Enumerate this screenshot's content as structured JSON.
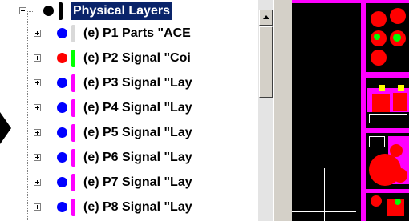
{
  "tree": {
    "root": {
      "label": "Physical Layers"
    },
    "items": [
      {
        "label": "(e) P1 Parts \"ACE",
        "dot_color": "#0000ff",
        "bar_color": "#d9d9d9"
      },
      {
        "label": "(e) P2 Signal \"Coi",
        "dot_color": "#ff0000",
        "bar_color": "#00ff00"
      },
      {
        "label": "(e) P3 Signal \"Lay",
        "dot_color": "#0000ff",
        "bar_color": "#ff00ff"
      },
      {
        "label": "(e) P4 Signal \"Lay",
        "dot_color": "#0000ff",
        "bar_color": "#ff00ff"
      },
      {
        "label": "(e) P5 Signal \"Lay",
        "dot_color": "#0000ff",
        "bar_color": "#ff00ff"
      },
      {
        "label": "(e) P6 Signal \"Lay",
        "dot_color": "#0000ff",
        "bar_color": "#ff00ff"
      },
      {
        "label": "(e) P7 Signal \"Lay",
        "dot_color": "#0000ff",
        "bar_color": "#ff00ff"
      },
      {
        "label": "(e) P8 Signal \"Lay",
        "dot_color": "#0000ff",
        "bar_color": "#ff00ff"
      }
    ]
  },
  "colors": {
    "selection": "#0a246a",
    "pcb_background": "#000000",
    "pcb_trace": "#ff00ff",
    "pcb_pad": "#ff0000"
  }
}
